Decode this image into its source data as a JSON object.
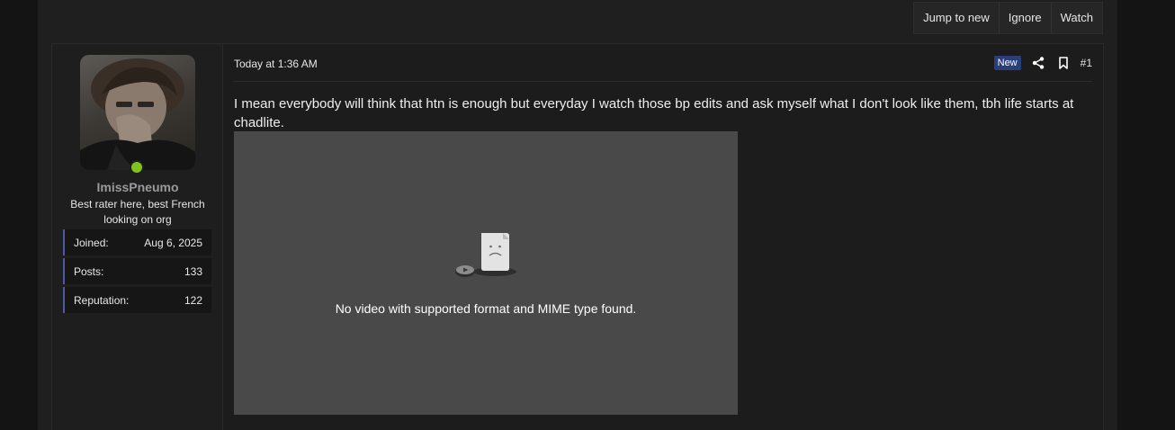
{
  "thread_actions": {
    "jump_to_new": "Jump to new",
    "ignore": "Ignore",
    "watch": "Watch"
  },
  "user": {
    "username": "ImissPneumo",
    "title": "Best rater here, best French looking on org",
    "online": true,
    "stats": [
      {
        "label": "Joined:",
        "value": "Aug 6, 2025"
      },
      {
        "label": "Posts:",
        "value": "133"
      },
      {
        "label": "Reputation:",
        "value": "122"
      }
    ]
  },
  "post": {
    "date": "Today at 1:36 AM",
    "badge": "New",
    "number": "#1",
    "body": "I mean everybody will think that htn is enough but everyday I watch those bp edits and ask myself what I don't look like them, tbh life starts at chadlite.",
    "video_error": "No video with supported format and MIME type found."
  },
  "colors": {
    "online": "#7fc41d",
    "accent": "#4a5aa8",
    "badge": "#2a3f7a"
  }
}
